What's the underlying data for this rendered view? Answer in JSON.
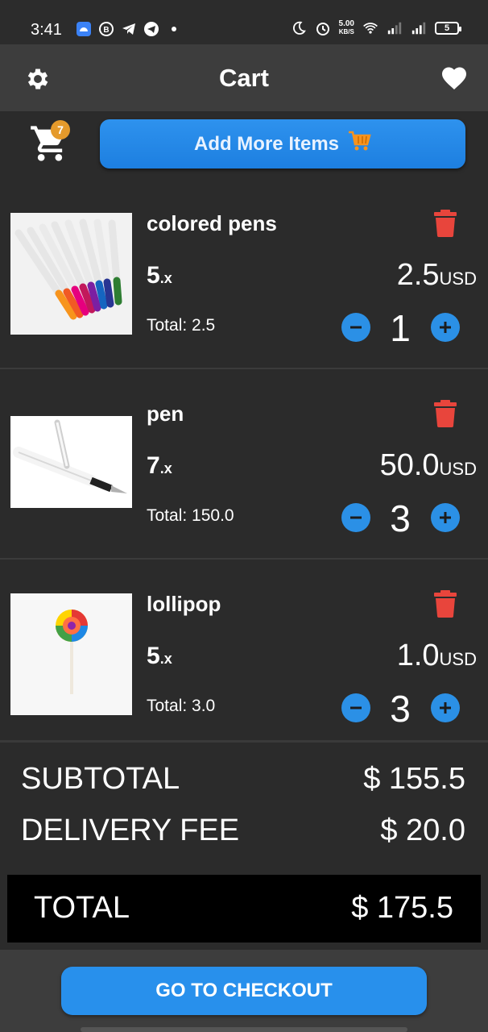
{
  "status_bar": {
    "time": "3:41",
    "speed_value": "5.00",
    "speed_unit": "KB/S",
    "battery": "5"
  },
  "app_bar": {
    "title": "Cart",
    "left_icon": "gear-icon",
    "right_icon": "heart-icon"
  },
  "actions": {
    "cart_count": "7",
    "add_more_label": "Add More Items"
  },
  "items": [
    {
      "name": "colored pens",
      "qty": "5",
      "qty_suffix": ".x",
      "price": "2.5",
      "currency": "USD",
      "total": "Total: 2.5",
      "count": "1",
      "image": "colored-pens-image"
    },
    {
      "name": "pen",
      "qty": "7",
      "qty_suffix": ".x",
      "price": "50.0",
      "currency": "USD",
      "total": "Total: 150.0",
      "count": "3",
      "image": "fountain-pen-image"
    },
    {
      "name": "lollipop",
      "qty": "5",
      "qty_suffix": ".x",
      "price": "1.0",
      "currency": "USD",
      "total": "Total: 3.0",
      "count": "3",
      "image": "lollipop-image"
    }
  ],
  "summary": {
    "subtotal_label": "SUBTOTAL",
    "subtotal_value": "$ 155.5",
    "delivery_label": "DELIVERY FEE",
    "delivery_value": "$ 20.0",
    "total_label": "TOTAL",
    "total_value": "$ 175.5"
  },
  "checkout": {
    "label": "GO TO CHECKOUT"
  },
  "colors": {
    "accent": "#2890ec",
    "delete": "#e8453c",
    "badge": "#e59a2b"
  }
}
